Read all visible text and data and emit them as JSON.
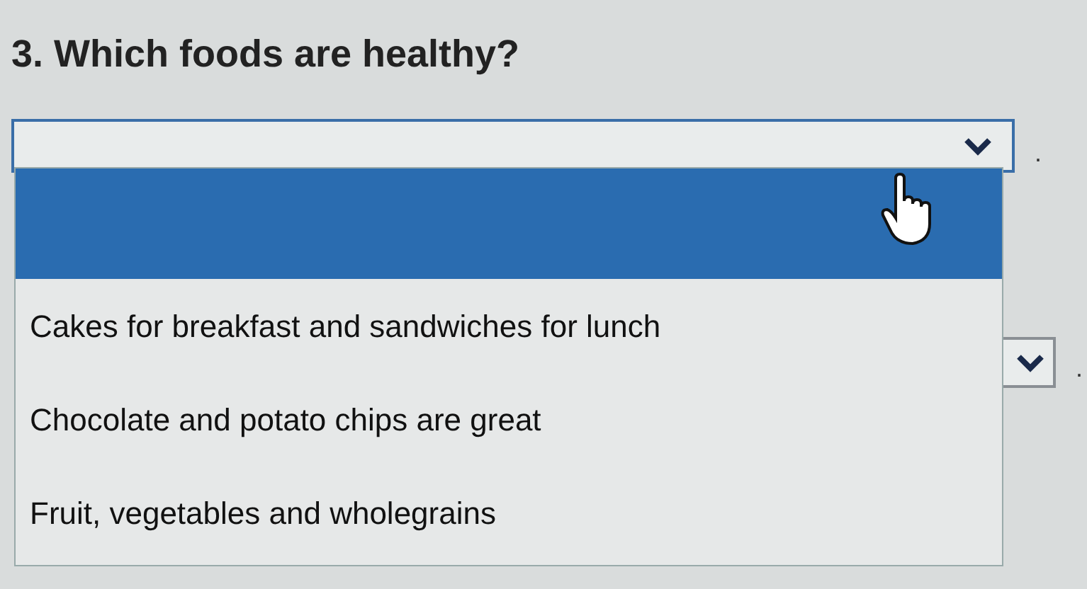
{
  "question": {
    "title": "3. Which foods are healthy?"
  },
  "select": {
    "expanded": true,
    "after": "."
  },
  "options": [
    {
      "kind": "blank",
      "selected": true
    },
    {
      "kind": "text",
      "label": "Cakes for breakfast and sandwiches for lunch",
      "selected": false
    },
    {
      "kind": "text",
      "label": "Chocolate and potato chips are great",
      "selected": false
    },
    {
      "kind": "text",
      "label": "Fruit, vegetables and wholegrains",
      "selected": false
    }
  ],
  "next_select": {
    "after": "."
  }
}
